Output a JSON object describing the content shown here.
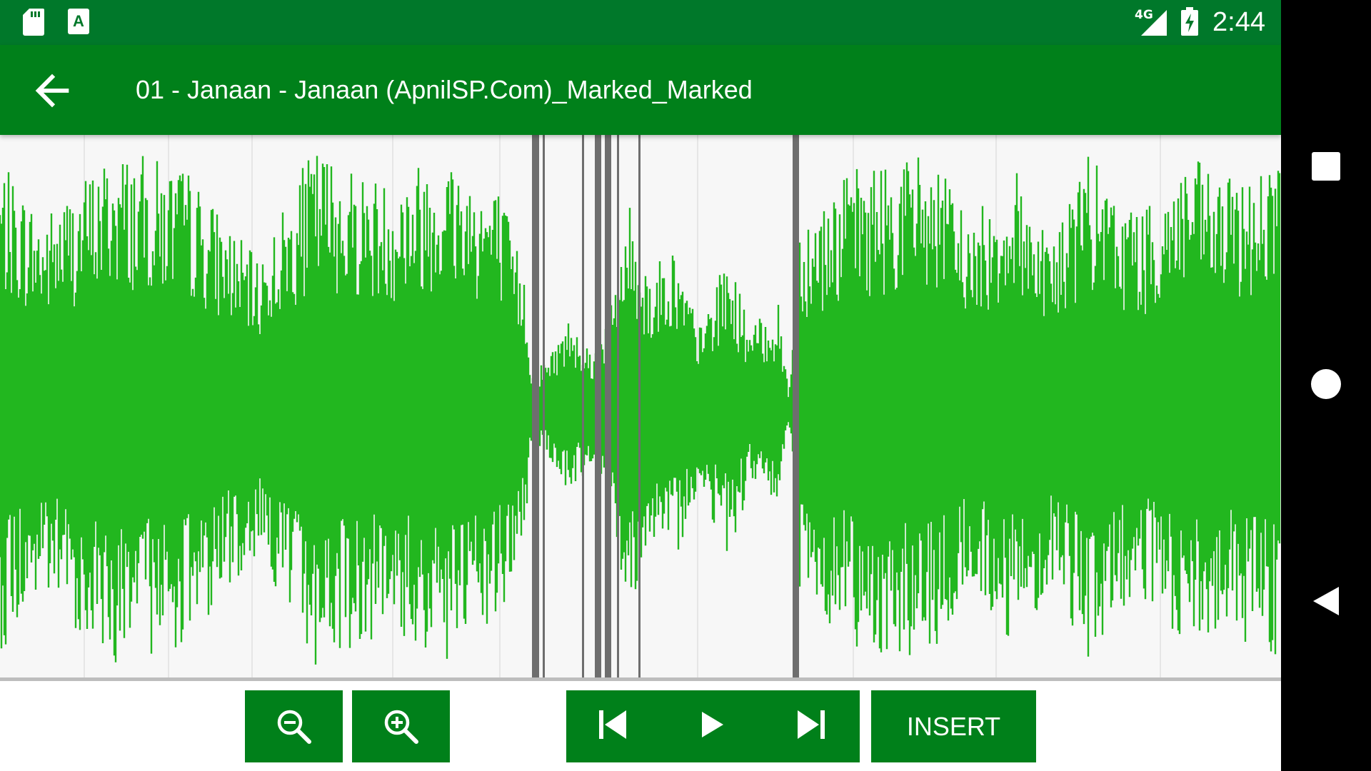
{
  "status_bar": {
    "time": "2:44",
    "network": "4G",
    "icons": [
      "sd-card-icon",
      "app-notification-icon",
      "signal-icon",
      "battery-charging-icon"
    ]
  },
  "toolbar": {
    "back_icon": "arrow-back-icon",
    "title": "01 - Janaan - Janaan (ApnilSP.Com)_Marked_Marked"
  },
  "controls": {
    "zoom_out_icon": "zoom-out-icon",
    "zoom_in_icon": "zoom-in-icon",
    "skip_previous_icon": "skip-previous-icon",
    "play_icon": "play-icon",
    "skip_next_icon": "skip-next-icon",
    "insert_label": "INSERT"
  },
  "navigation_bar": {
    "icons": [
      "recents-square-icon",
      "home-circle-icon",
      "back-triangle-icon"
    ]
  },
  "colors": {
    "status_bar": "#00782a",
    "toolbar": "#00801a",
    "waveform": "#22b71f",
    "waveform_bg": "#f7f7f7",
    "marker": "#6e6e6e",
    "button": "#00801a"
  }
}
